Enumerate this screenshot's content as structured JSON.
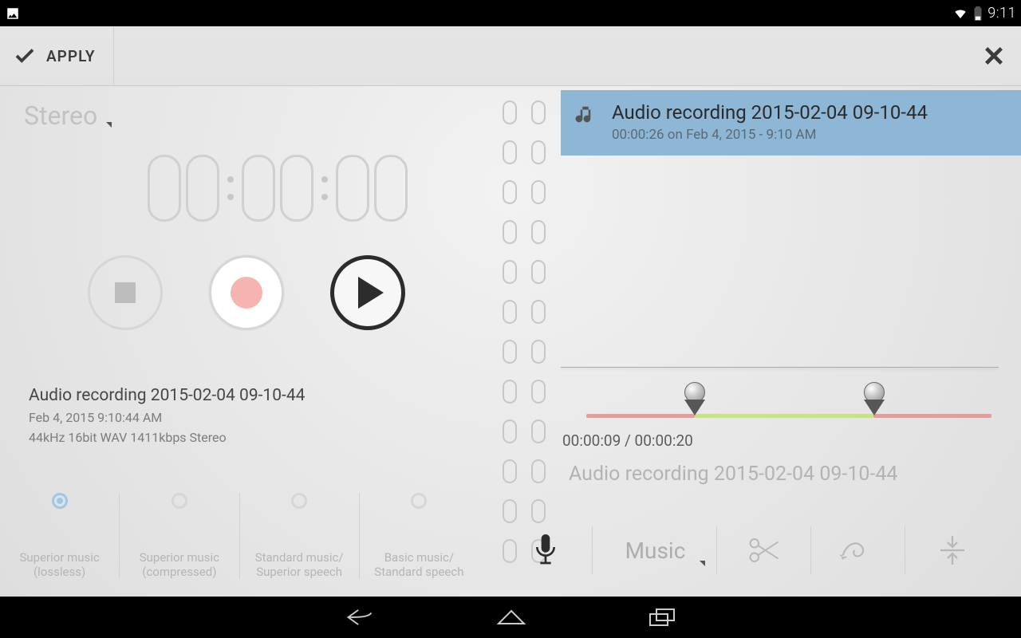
{
  "status": {
    "time": "9:11"
  },
  "actionbar": {
    "apply_label": "APPLY"
  },
  "recorder": {
    "mode_label": "Stereo",
    "timer": "00:00:00",
    "file": {
      "title": "Audio recording 2015-02-04 09-10-44",
      "date": "Feb 4, 2015 9:10:44 AM",
      "format": "44kHz 16bit WAV 1411kbps Stereo"
    },
    "quality_options": [
      {
        "l1": "Superior music",
        "l2": "(lossless)",
        "selected": true
      },
      {
        "l1": "Superior music",
        "l2": "(compressed)",
        "selected": false
      },
      {
        "l1": "Standard music/",
        "l2": "Superior speech",
        "selected": false
      },
      {
        "l1": "Basic music/",
        "l2": "Standard speech",
        "selected": false
      }
    ]
  },
  "playlist": {
    "item": {
      "title": "Audio recording 2015-02-04 09-10-44",
      "subtitle": "00:00:26 on Feb 4, 2015 - 9:10 AM"
    }
  },
  "trim": {
    "time_label": "00:00:09 / 00:00:20",
    "name": "Audio recording 2015-02-04 09-10-44"
  },
  "right_toolbar": {
    "category_label": "Music"
  }
}
